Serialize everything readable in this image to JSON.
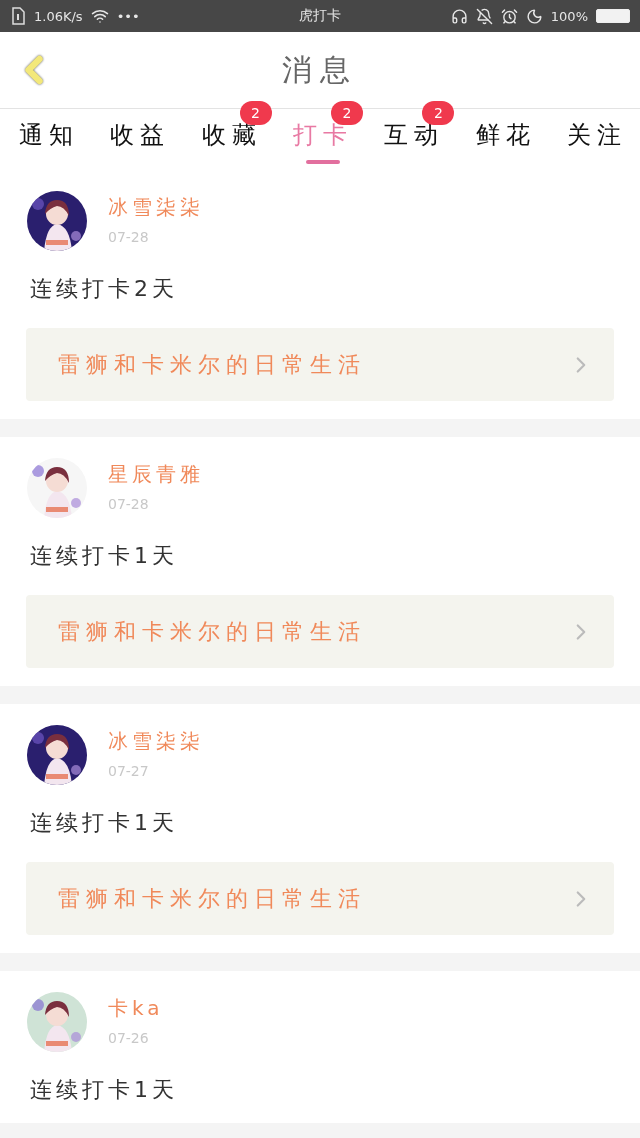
{
  "status_bar": {
    "speed": "1.06K/s",
    "dots": "•••",
    "title": "虎打卡",
    "battery": "100%"
  },
  "header": {
    "title": "消息"
  },
  "tabs": [
    {
      "label": "通知",
      "selected": false
    },
    {
      "label": "收益",
      "selected": false
    },
    {
      "label": "收藏",
      "selected": false,
      "badge": "2"
    },
    {
      "label": "打卡",
      "selected": true,
      "badge": "2"
    },
    {
      "label": "互动",
      "selected": false,
      "badge": "2"
    },
    {
      "label": "鲜花",
      "selected": false
    },
    {
      "label": "关注",
      "selected": false
    }
  ],
  "posts": [
    {
      "name": "冰雪柒柒",
      "date": "07-28",
      "text": "连续打卡2天",
      "link": "雷狮和卡米尔的日常生活"
    },
    {
      "name": "星辰青雅",
      "date": "07-28",
      "text": "连续打卡1天",
      "link": "雷狮和卡米尔的日常生活"
    },
    {
      "name": "冰雪柒柒",
      "date": "07-27",
      "text": "连续打卡1天",
      "link": "雷狮和卡米尔的日常生活"
    },
    {
      "name": "卡ka",
      "date": "07-26",
      "text": "连续打卡1天"
    }
  ]
}
